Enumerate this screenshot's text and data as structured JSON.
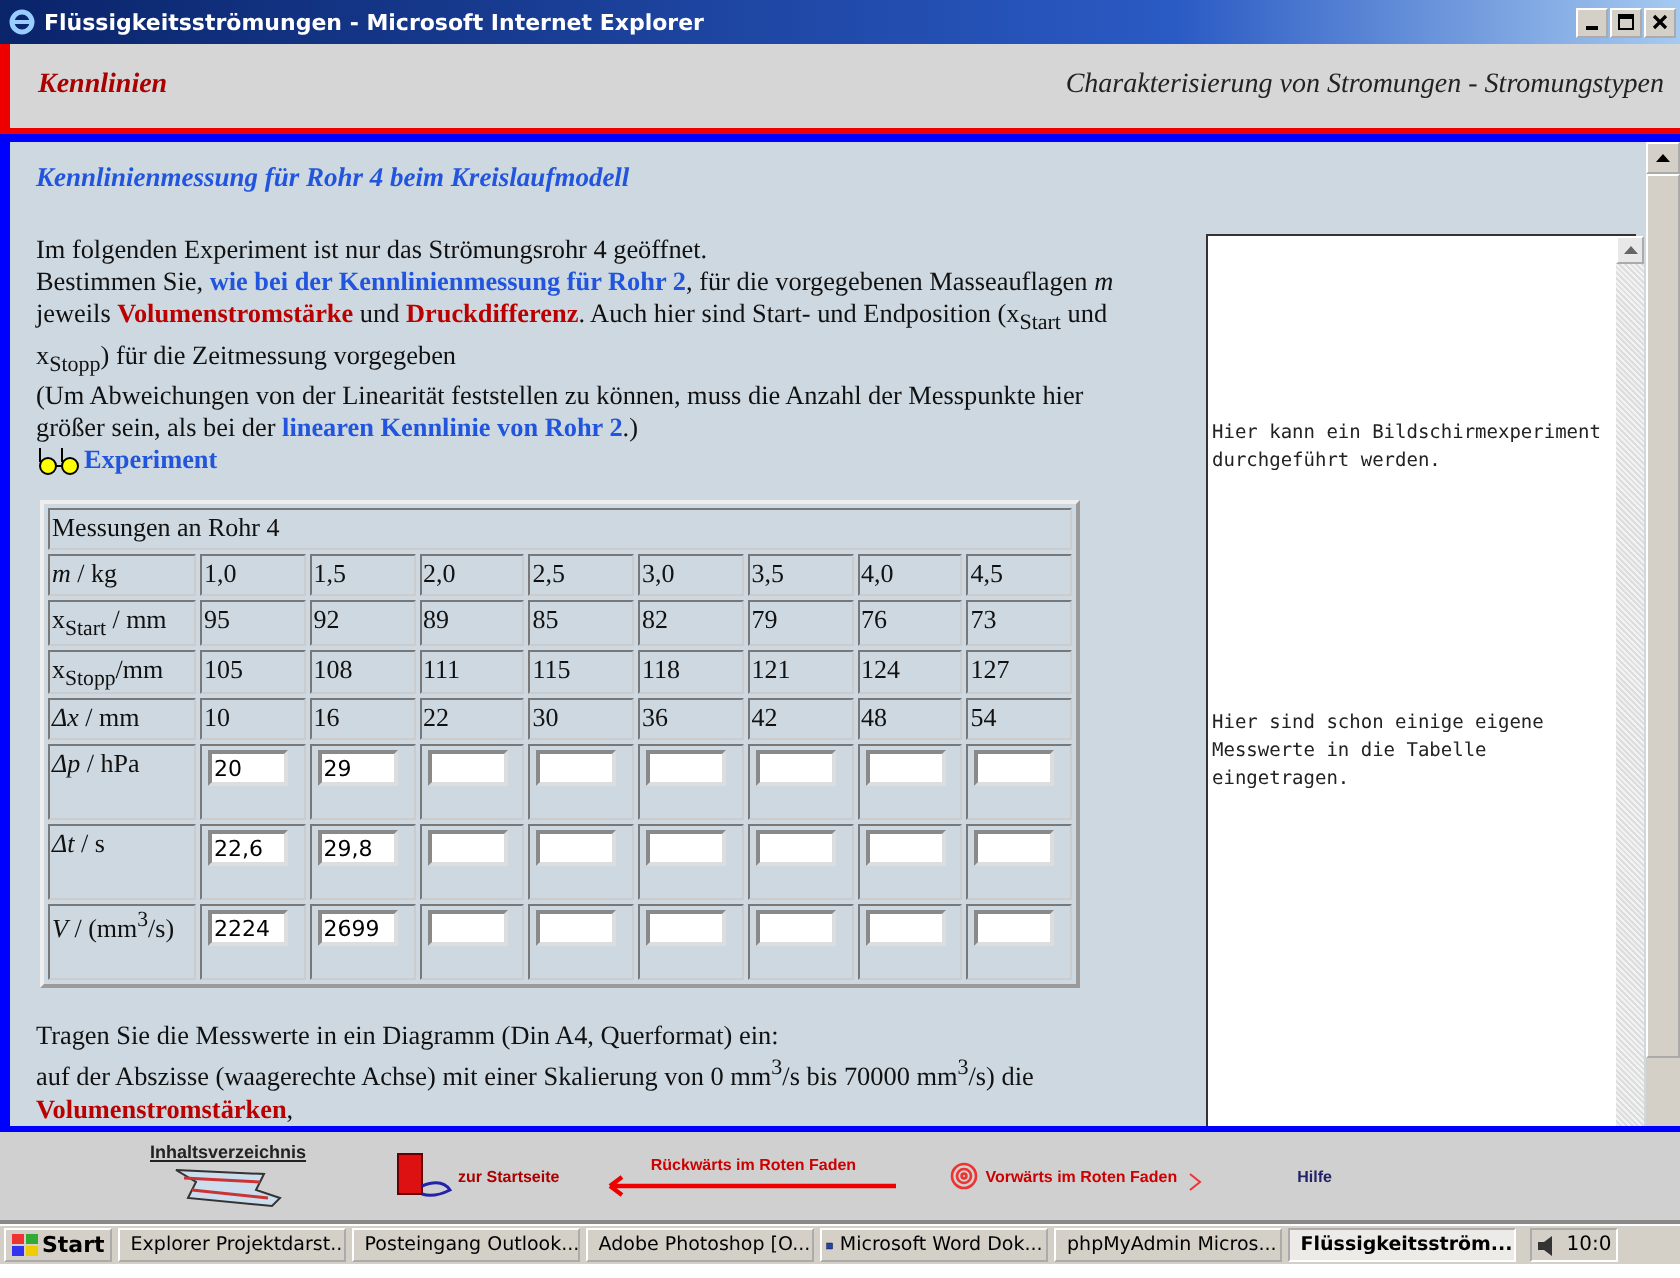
{
  "window": {
    "title": "Flüssigkeitsströmungen - Microsoft Internet Explorer"
  },
  "header": {
    "section": "Kennlinien",
    "topic": "Charakterisierung von Stromungen - Stromungstypen"
  },
  "page": {
    "heading": "Kennlinienmessung für Rohr 4 beim Kreislaufmodell",
    "intro": [
      [
        {
          "kind": "plain",
          "text": "Im folgenden Experiment ist nur das Strömungsrohr 4 geöffnet."
        }
      ],
      [
        {
          "kind": "plain",
          "text": "Bestimmen Sie, "
        },
        {
          "kind": "link",
          "text": "wie bei der Kennlinienmessung für Rohr 2"
        },
        {
          "kind": "plain",
          "text": ", für die vorgegebenen Masseauflagen *m* jeweils "
        },
        {
          "kind": "term",
          "text": "Volumenstromstärke"
        },
        {
          "kind": "plain",
          "text": " und "
        },
        {
          "kind": "term",
          "text": "Druckdifferenz"
        },
        {
          "kind": "plain",
          "text": ". Auch hier sind Start- und Endposition (x$_{Start}$ und x$_{Stopp}$) für die Zeitmessung vorgegeben"
        }
      ],
      [
        {
          "kind": "plain",
          "text": "(Um Abweichungen von der Linearität feststellen zu können, muss die Anzahl der Messpunkte hier größer sein, als bei der "
        },
        {
          "kind": "link",
          "text": "linearen Kennlinie von Rohr 2"
        },
        {
          "kind": "plain",
          "text": ".)"
        }
      ]
    ],
    "experiment_link": "Experiment",
    "table": {
      "caption": "Messungen an Rohr 4",
      "rows": [
        {
          "label": "*m* / kg",
          "kind": "text",
          "cells": [
            "1,0",
            "1,5",
            "2,0",
            "2,5",
            "3,0",
            "3,5",
            "4,0",
            "4,5"
          ]
        },
        {
          "label": "x$_{Start}$ / mm",
          "kind": "text",
          "cells": [
            "95",
            "92",
            "89",
            "85",
            "82",
            "79",
            "76",
            "73"
          ]
        },
        {
          "label": "x$_{Stopp}$/mm",
          "kind": "text",
          "cells": [
            "105",
            "108",
            "111",
            "115",
            "118",
            "121",
            "124",
            "127"
          ]
        },
        {
          "label": "*Δx* / mm",
          "kind": "text",
          "cells": [
            "10",
            "16",
            "22",
            "30",
            "36",
            "42",
            "48",
            "54"
          ]
        },
        {
          "label": "*Δp* / hPa",
          "kind": "input",
          "cells": [
            {
              "value": "20"
            },
            {
              "value": "29"
            },
            {},
            {},
            {},
            {},
            {},
            {}
          ]
        },
        {
          "label": "*Δt* / s",
          "kind": "input",
          "cells": [
            {
              "value": "22,6"
            },
            {
              "value": "29,8"
            },
            {},
            {},
            {},
            {},
            {},
            {}
          ]
        },
        {
          "label": "*V* / (mm$^{3}$/s)",
          "kind": "input",
          "cells": [
            {
              "value": "2224"
            },
            {
              "value": "2699"
            },
            {},
            {},
            {},
            {},
            {},
            {}
          ]
        }
      ]
    },
    "outro": [
      [
        {
          "kind": "plain",
          "text": "Tragen Sie die Messwerte in ein Diagramm (Din A4, Querformat) ein:"
        }
      ],
      [
        {
          "kind": "plain",
          "text": "auf der Abszisse (waagerechte Achse) mit einer Skalierung von 0 mm$^{3}$/s bis 70000 mm$^{3}$/s) die"
        },
        {
          "kind": "term",
          "text": "Volumenstromstärken"
        },
        {
          "kind": "plain",
          "text": ","
        }
      ]
    ],
    "side_panel": [
      "Hier kann ein Bildschirmexperiment durchgeführt werden.",
      "Hier sind schon einige eigene Messwerte in die Tabelle eingetragen."
    ]
  },
  "nav": [
    {
      "kind": "contents",
      "label": "Inhaltsverzeichnis"
    },
    {
      "kind": "home",
      "label": "zur Startseite"
    },
    {
      "kind": "back",
      "label": "Rückwärts im Roten Faden"
    },
    {
      "kind": "forward",
      "label": "Vorwärts im Roten Faden"
    },
    {
      "kind": "help",
      "label": "Hilfe"
    }
  ],
  "taskbar": {
    "start": "Start",
    "tasks": [
      {
        "label": "Explorer  Projektdarst...",
        "selected": false
      },
      {
        "label": "Posteingang  Outlook...",
        "selected": false
      },
      {
        "label": "Adobe Photoshop  [O...",
        "selected": false
      },
      {
        "label": "Microsoft Word  Dok...",
        "selected": false
      },
      {
        "label": "phpMyAdmin  Micros...",
        "selected": false
      },
      {
        "label": "Flüssigkeitsström...",
        "selected": true
      }
    ],
    "clock": "10:0"
  }
}
